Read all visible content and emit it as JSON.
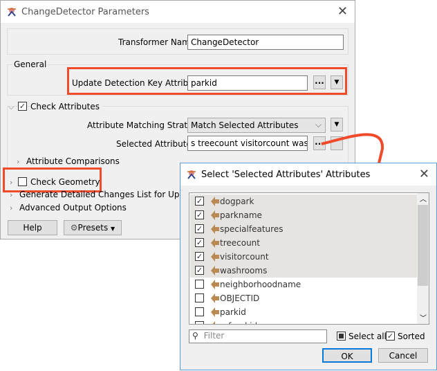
{
  "main_dialog": {
    "title": "ChangeDetector Parameters",
    "transformer_name_label": "Transformer Name:",
    "transformer_name_value": "ChangeDetector",
    "general_label": "General",
    "update_key_label": "Update Detection Key Attributes:",
    "update_key_value": "parkid",
    "ellipsis": "...",
    "check_attributes_label": "Check Attributes",
    "check_attributes_checked": true,
    "matching_strategy_label": "Attribute Matching Strategy:",
    "matching_strategy_value": "Match Selected Attributes",
    "selected_attributes_label": "Selected Attributes:",
    "selected_attributes_value": "s treecount visitorcount washrooms",
    "attribute_comparisons_label": "Attribute Comparisons",
    "check_geometry_label": "Check Geometry",
    "check_geometry_checked": false,
    "generate_changes_label": "Generate Detailed Changes List for Update Detec",
    "advanced_output_label": "Advanced Output Options",
    "help_button": "Help",
    "presets_button": "Presets"
  },
  "select_dialog": {
    "title": "Select 'Selected Attributes' Attributes",
    "attributes": [
      {
        "name": "dogpark",
        "checked": true
      },
      {
        "name": "parkname",
        "checked": true
      },
      {
        "name": "specialfeatures",
        "checked": true
      },
      {
        "name": "treecount",
        "checked": true
      },
      {
        "name": "visitorcount",
        "checked": true
      },
      {
        "name": "washrooms",
        "checked": true
      },
      {
        "name": "neighborhoodname",
        "checked": false
      },
      {
        "name": "OBJECTID",
        "checked": false
      },
      {
        "name": "parkid",
        "checked": false
      },
      {
        "name": "refparkid",
        "checked": false
      }
    ],
    "filter_placeholder": "Filter",
    "select_all_label": "Select all",
    "sorted_label": "Sorted",
    "ok_button": "OK",
    "cancel_button": "Cancel"
  },
  "colors": {
    "highlight": "#f04a2b",
    "attr_icon": "#b98a54"
  }
}
